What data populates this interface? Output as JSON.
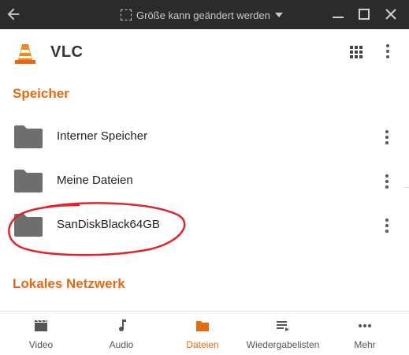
{
  "window": {
    "resize_label": "Größe kann geändert werden"
  },
  "app": {
    "title": "VLC",
    "accent": "#e56a14"
  },
  "sections": {
    "storage_title": "Speicher",
    "network_title": "Lokales Netzwerk"
  },
  "storage_items": [
    {
      "label": "Interner Speicher"
    },
    {
      "label": "Meine Dateien"
    },
    {
      "label": "SanDiskBlack64GB"
    }
  ],
  "nav": [
    {
      "label": "Video",
      "icon": "video-icon"
    },
    {
      "label": "Audio",
      "icon": "music-icon"
    },
    {
      "label": "Dateien",
      "icon": "folder-icon",
      "active": true
    },
    {
      "label": "Wiedergabelisten",
      "icon": "playlist-icon"
    },
    {
      "label": "Mehr",
      "icon": "more-icon"
    }
  ]
}
